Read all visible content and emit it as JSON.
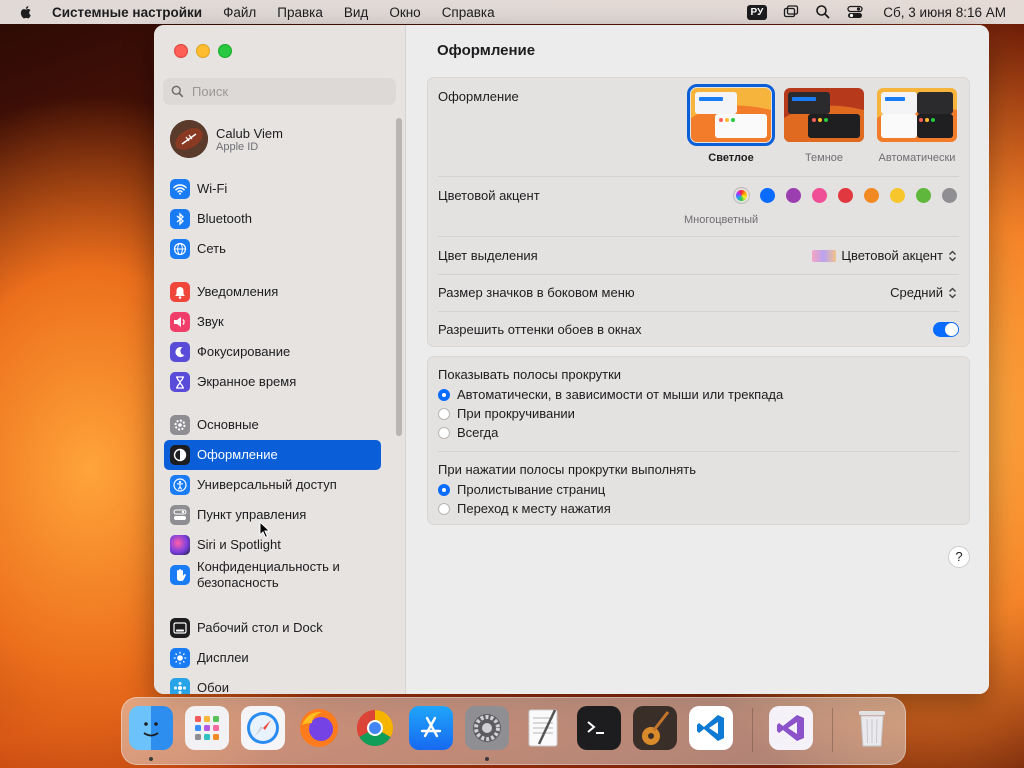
{
  "menubar": {
    "app_name": "Системные настройки",
    "items": [
      "Файл",
      "Правка",
      "Вид",
      "Окно",
      "Справка"
    ],
    "keyboard_layout": "РУ",
    "datetime": "Сб, 3 июня  8:16 AM"
  },
  "sidebar": {
    "search_placeholder": "Поиск",
    "account": {
      "name": "Calub Viem",
      "subtitle": "Apple ID"
    },
    "items": [
      {
        "label": "Wi-Fi",
        "icon": "wifi-icon",
        "color": "#1a7cf5"
      },
      {
        "label": "Bluetooth",
        "icon": "bluetooth-icon",
        "color": "#1a7cf5"
      },
      {
        "label": "Сеть",
        "icon": "globe-icon",
        "color": "#1a7cf5"
      },
      {
        "label": "Уведомления",
        "icon": "bell-icon",
        "color": "#f0453a"
      },
      {
        "label": "Звук",
        "icon": "speaker-icon",
        "color": "#ef3e6a"
      },
      {
        "label": "Фокусирование",
        "icon": "moon-icon",
        "color": "#5b4bd9"
      },
      {
        "label": "Экранное время",
        "icon": "hourglass-icon",
        "color": "#5b4bd9"
      },
      {
        "label": "Основные",
        "icon": "gear-icon",
        "color": "#8e8e93"
      },
      {
        "label": "Оформление",
        "icon": "appearance-icon",
        "color": "#1d1d1f",
        "active": true
      },
      {
        "label": "Универсальный доступ",
        "icon": "accessibility-icon",
        "color": "#1a7cf5"
      },
      {
        "label": "Пункт управления",
        "icon": "control-center-icon",
        "color": "#8e8e93"
      },
      {
        "label": "Siri и Spotlight",
        "icon": "siri-icon",
        "color": "#8a3cd6"
      },
      {
        "label": "Конфиденциальность и безопасность",
        "icon": "hand-icon",
        "color": "#1a7cf5"
      },
      {
        "label": "Рабочий стол и Dock",
        "icon": "dock-icon",
        "color": "#1d1d1f"
      },
      {
        "label": "Дисплеи",
        "icon": "sun-icon",
        "color": "#1a7cf5"
      },
      {
        "label": "Обои",
        "icon": "wallpaper-icon",
        "color": "#27a3e8"
      }
    ]
  },
  "main": {
    "title": "Оформление",
    "appearance": {
      "label": "Оформление",
      "options": [
        {
          "label": "Светлое",
          "selected": true
        },
        {
          "label": "Темное",
          "selected": false
        },
        {
          "label": "Автоматически",
          "selected": false
        }
      ]
    },
    "accent": {
      "label": "Цветовой акцент",
      "caption": "Многоцветный",
      "colors": [
        "multicolor",
        "#0a6cff",
        "#9b3fb0",
        "#ef4f97",
        "#e0383e",
        "#f28a24",
        "#f7c62d",
        "#5fb73c",
        "#8e8e93"
      ]
    },
    "highlight": {
      "label": "Цвет выделения",
      "value": "Цветовой акцент"
    },
    "icon_size": {
      "label": "Размер значков в боковом меню",
      "value": "Средний"
    },
    "tinting": {
      "label": "Разрешить оттенки обоев в окнах",
      "enabled": true
    },
    "scrollbars": {
      "label": "Показывать полосы прокрутки",
      "options": [
        {
          "label": "Автоматически, в зависимости от мыши или трекпада",
          "selected": true
        },
        {
          "label": "При прокручивании",
          "selected": false
        },
        {
          "label": "Всегда",
          "selected": false
        }
      ]
    },
    "click_scroll": {
      "label": "При нажатии полосы прокрутки выполнять",
      "options": [
        {
          "label": "Пролистывание страниц",
          "selected": true
        },
        {
          "label": "Переход к месту нажатия",
          "selected": false
        }
      ]
    },
    "help_label": "?"
  },
  "dock": {
    "apps": [
      "Finder",
      "Launchpad",
      "Safari",
      "Firefox",
      "Chrome",
      "App Store",
      "Системные настройки",
      "TextEdit",
      "Терминал",
      "GarageBand",
      "Visual Studio Code",
      "Visual Studio",
      "Корзина"
    ]
  }
}
